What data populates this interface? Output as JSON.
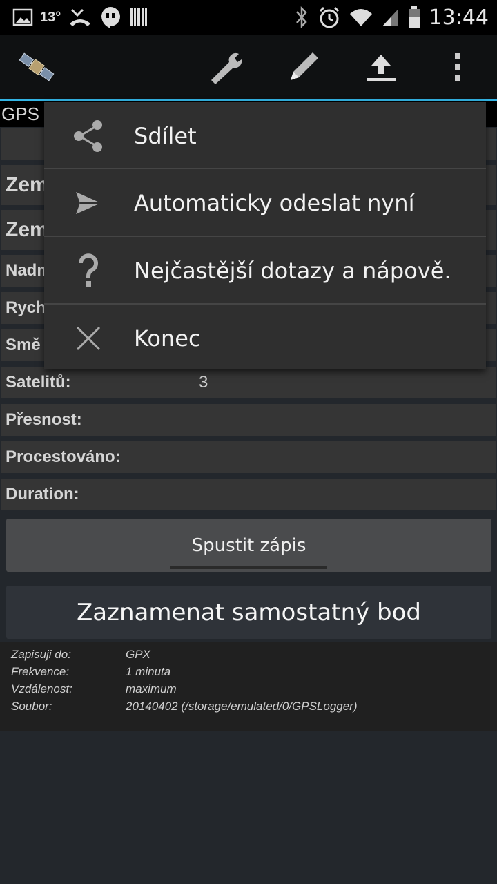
{
  "status_bar": {
    "temperature": "13°",
    "time": "13:44",
    "icons": [
      "image-icon",
      "missed-call-icon",
      "hangouts-icon",
      "barcode-icon",
      "bluetooth-icon",
      "alarm-icon",
      "wifi-icon",
      "signal-icon",
      "battery-icon"
    ]
  },
  "action_bar": {
    "icons": [
      "satellite-icon",
      "wrench-icon",
      "pencil-icon",
      "upload-icon",
      "overflow-menu-icon"
    ]
  },
  "gps_strip_text": "GPS",
  "rows": [
    {
      "label": "Zem",
      "value": ""
    },
    {
      "label": "Zem",
      "value": ""
    },
    {
      "label": "Nadm",
      "value": ""
    },
    {
      "label": "Rych",
      "value": ""
    },
    {
      "label": "Smě",
      "value": ""
    },
    {
      "label": "Satelitů:",
      "value": "3"
    },
    {
      "label": "Přesnost:",
      "value": ""
    },
    {
      "label": "Procestováno:",
      "value": ""
    },
    {
      "label": "Duration:",
      "value": ""
    }
  ],
  "buttons": {
    "start_logging": "Spustit zápis",
    "log_single_point": "Zaznamenat samostatný bod"
  },
  "info": [
    {
      "key": "Zapisuji do:",
      "value": "GPX"
    },
    {
      "key": "Frekvence:",
      "value": "1 minuta"
    },
    {
      "key": "Vzdálenost:",
      "value": "maximum"
    },
    {
      "key": "Soubor:",
      "value": "20140402 (/storage/emulated/0/GPSLogger)"
    }
  ],
  "overflow_menu": {
    "items": [
      {
        "label": "Sdílet",
        "icon": "share-icon"
      },
      {
        "label": "Automaticky odeslat nyní",
        "icon": "send-icon"
      },
      {
        "label": "Nejčastější dotazy a nápově.",
        "icon": "help-icon"
      },
      {
        "label": "Konec",
        "icon": "close-icon"
      }
    ]
  },
  "colors": {
    "accent": "#33b5e5",
    "background": "#23272c",
    "menu_background": "#2f2f2f"
  }
}
